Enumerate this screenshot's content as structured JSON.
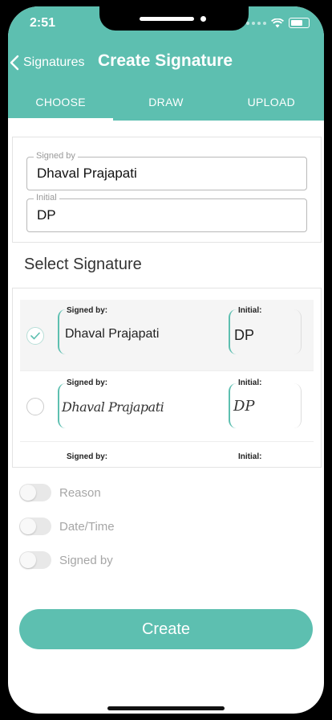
{
  "status": {
    "time": "2:51"
  },
  "nav": {
    "back_label": "Signatures",
    "title": "Create Signature"
  },
  "tabs": [
    {
      "label": "CHOOSE",
      "active": true
    },
    {
      "label": "DRAW",
      "active": false
    },
    {
      "label": "UPLOAD",
      "active": false
    }
  ],
  "form": {
    "signed_by": {
      "label": "Signed by",
      "value": "Dhaval Prajapati"
    },
    "initial": {
      "label": "Initial",
      "value": "DP"
    }
  },
  "select_signature": {
    "title": "Select Signature",
    "items": [
      {
        "signed_by_label": "Signed by:",
        "signed_by": "Dhaval Prajapati",
        "initial_label": "Initial:",
        "initial": "DP",
        "style": "typed",
        "selected": true
      },
      {
        "signed_by_label": "Signed by:",
        "signed_by": "Dhaval Prajapati",
        "initial_label": "Initial:",
        "initial": "DP",
        "style": "handwritten",
        "selected": false
      },
      {
        "signed_by_label": "Signed by:",
        "initial_label": "Initial:",
        "selected": false
      }
    ]
  },
  "options": [
    {
      "label": "Reason",
      "enabled": false
    },
    {
      "label": "Date/Time",
      "enabled": false
    },
    {
      "label": "Signed by",
      "enabled": false
    }
  ],
  "create_button": {
    "label": "Create"
  },
  "colors": {
    "accent": "#5dbfb0"
  }
}
